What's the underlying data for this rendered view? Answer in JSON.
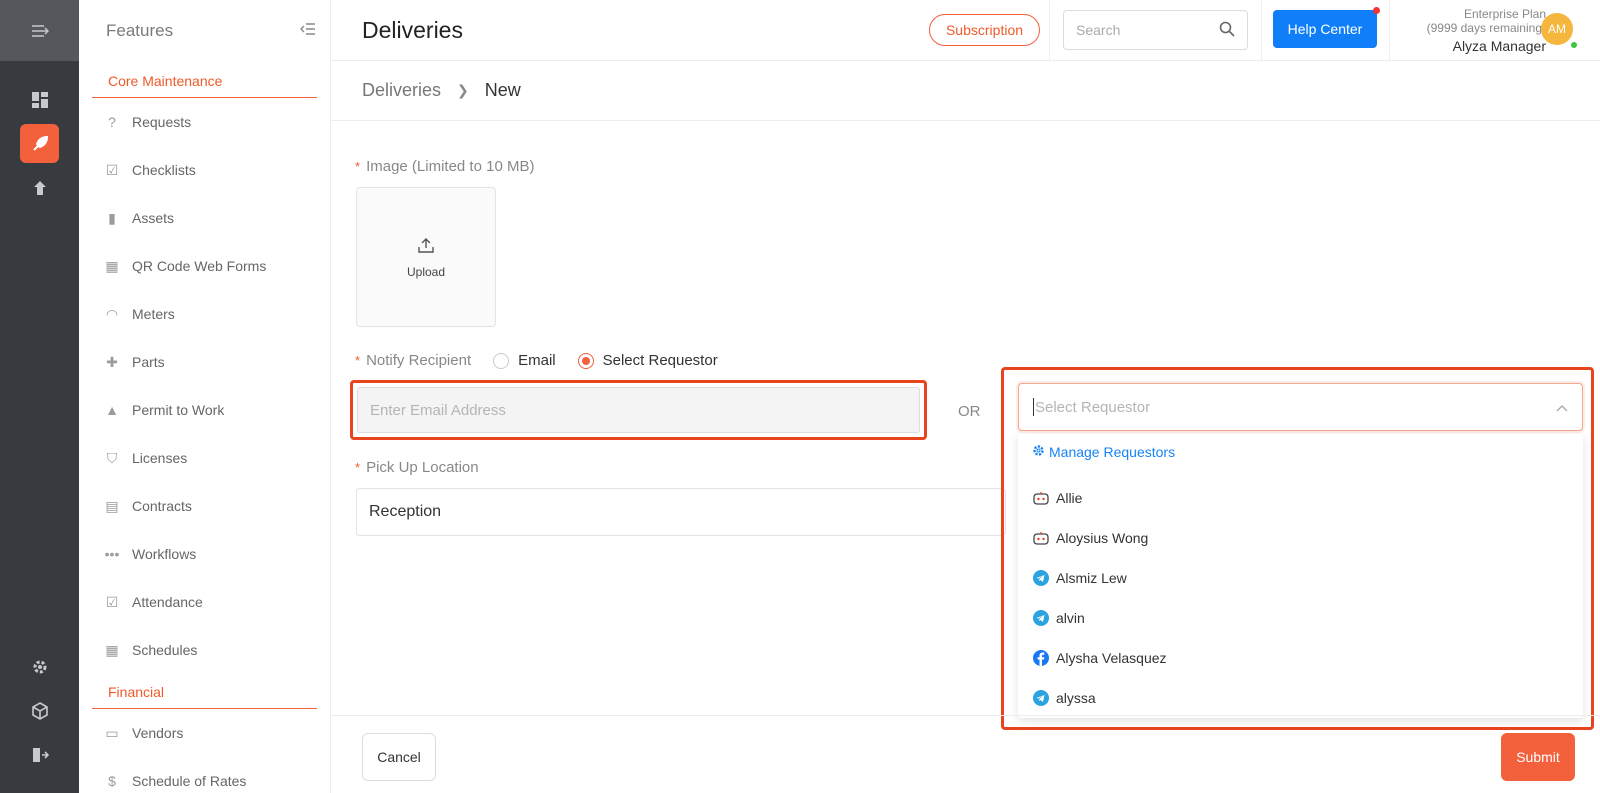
{
  "sidebar": {
    "header": "Features",
    "sections": [
      {
        "title": "Core Maintenance",
        "items": [
          "Requests",
          "Checklists",
          "Assets",
          "QR Code Web Forms",
          "Meters",
          "Parts",
          "Permit to Work",
          "Licenses",
          "Contracts",
          "Workflows",
          "Attendance",
          "Schedules"
        ]
      },
      {
        "title": "Financial",
        "items": [
          "Vendors",
          "Schedule of Rates"
        ]
      }
    ]
  },
  "header": {
    "title": "Deliveries",
    "subscription_label": "Subscription",
    "search_placeholder": "Search",
    "help_label": "Help Center",
    "plan_name": "Enterprise Plan",
    "plan_days": "(9999 days remaining)",
    "user_name": "Alyza Manager",
    "avatar_initials": "AM"
  },
  "breadcrumb": {
    "parent": "Deliveries",
    "current": "New"
  },
  "form": {
    "image_label": "Image (Limited to 10 MB)",
    "upload_label": "Upload",
    "notify_label": "Notify Recipient",
    "radio_email": "Email",
    "radio_requestor": "Select Requestor",
    "radio_selected": "Select Requestor",
    "email_placeholder": "Enter Email Address",
    "or_label": "OR",
    "select_placeholder": "Select Requestor",
    "pickup_label": "Pick Up Location",
    "pickup_value": "Reception",
    "cancel_label": "Cancel",
    "submit_label": "Submit"
  },
  "dropdown": {
    "manage_label": "Manage Requestors",
    "options": [
      {
        "name": "Allie",
        "icon": "bot-icon"
      },
      {
        "name": "Aloysius Wong",
        "icon": "bot-icon"
      },
      {
        "name": "Alsmiz Lew",
        "icon": "telegram-icon"
      },
      {
        "name": "alvin",
        "icon": "telegram-icon"
      },
      {
        "name": "Alysha Velasquez",
        "icon": "facebook-icon"
      },
      {
        "name": "alyssa",
        "icon": "telegram-icon"
      }
    ]
  },
  "colors": {
    "accent": "#f2603c",
    "primary_blue": "#0f7ef8",
    "rail_bg": "#373a3f",
    "highlight": "#e8451f"
  }
}
